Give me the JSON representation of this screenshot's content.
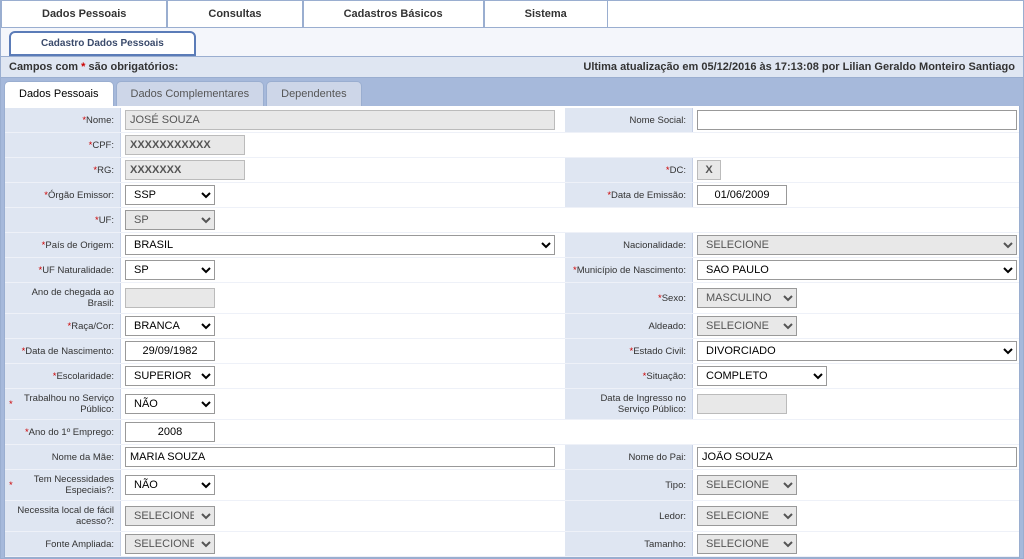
{
  "topnav": {
    "dados_pessoais": "Dados Pessoais",
    "consultas": "Consultas",
    "cadastros_basicos": "Cadastros Básicos",
    "sistema": "Sistema"
  },
  "subtab": "Cadastro Dados Pessoais",
  "infobar": {
    "left_a": "Campos com ",
    "left_star": "*",
    "left_b": " são obrigatórios:",
    "right": "Ultima atualização em 05/12/2016 às 17:13:08 por Lilian Geraldo Monteiro Santiago"
  },
  "innertabs": {
    "dados_pessoais": "Dados Pessoais",
    "dados_complementares": "Dados Complementares",
    "dependentes": "Dependentes"
  },
  "labels": {
    "nome": "Nome:",
    "nome_social": "Nome Social:",
    "cpf": "CPF:",
    "rg": "RG:",
    "dc": "DC:",
    "orgao_emissor": "Órgão Emissor:",
    "data_emissao": "Data de Emissão:",
    "uf": "UF:",
    "pais_origem": "País de Origem:",
    "nacionalidade": "Nacionalidade:",
    "uf_naturalidade": "UF Naturalidade:",
    "municipio_nasc": "Município de Nascimento:",
    "ano_chegada": "Ano de chegada ao Brasil:",
    "sexo": "Sexo:",
    "raca_cor": "Raça/Cor:",
    "aldeado": "Aldeado:",
    "data_nasc": "Data de Nascimento:",
    "estado_civil": "Estado Civil:",
    "escolaridade": "Escolaridade:",
    "situacao": "Situação:",
    "trabalhou_sp": "Trabalhou no Serviço Público:",
    "data_ingresso": "Data de Ingresso no Serviço Público:",
    "ano_1_emprego": "Ano do 1º Emprego:",
    "nome_mae": "Nome da Mãe:",
    "nome_pai": "Nome do Pai:",
    "tem_necessidades": "Tem Necessidades Especiais?:",
    "tipo": "Tipo:",
    "necessita_local": "Necessita local de fácil acesso?:",
    "ledor": "Ledor:",
    "fonte_ampliada": "Fonte Ampliada:",
    "tamanho": "Tamanho:"
  },
  "values": {
    "nome": "JOSÉ SOUZA",
    "nome_social": "",
    "cpf": "XXXXXXXXXXX",
    "rg": "XXXXXXX",
    "dc": "X",
    "orgao_emissor": "SSP",
    "data_emissao": "01/06/2009",
    "uf": "SP",
    "pais_origem": "BRASIL",
    "nacionalidade": "SELECIONE",
    "uf_naturalidade": "SP",
    "municipio_nasc": "SAO PAULO",
    "ano_chegada": "",
    "sexo": "MASCULINO",
    "raca_cor": "BRANCA",
    "aldeado": "SELECIONE",
    "data_nasc": "29/09/1982",
    "estado_civil": "DIVORCIADO",
    "escolaridade": "SUPERIOR",
    "situacao": "COMPLETO",
    "trabalhou_sp": "NÃO",
    "data_ingresso": "",
    "ano_1_emprego": "2008",
    "nome_mae": "MARIA SOUZA",
    "nome_pai": "JOÃO SOUZA",
    "tem_necessidades": "NÃO",
    "tipo": "SELECIONE",
    "necessita_local": "SELECIONE",
    "ledor": "SELECIONE",
    "fonte_ampliada": "SELECIONE",
    "tamanho": "SELECIONE"
  }
}
